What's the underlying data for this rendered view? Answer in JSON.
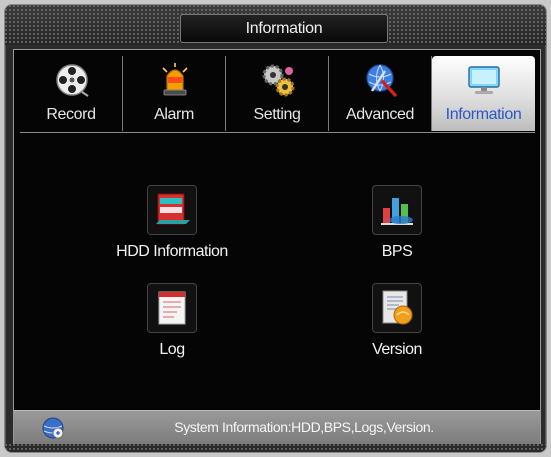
{
  "window": {
    "title": "Information"
  },
  "tabs": [
    {
      "label": "Record",
      "icon": "film-reel-icon"
    },
    {
      "label": "Alarm",
      "icon": "alarm-siren-icon"
    },
    {
      "label": "Setting",
      "icon": "gears-icon"
    },
    {
      "label": "Advanced",
      "icon": "globe-tools-icon"
    },
    {
      "label": "Information",
      "icon": "monitor-icon",
      "active": true
    }
  ],
  "items": [
    {
      "label": "HDD Information",
      "icon": "hdd-icon"
    },
    {
      "label": "BPS",
      "icon": "bar-chart-icon"
    },
    {
      "label": "Log",
      "icon": "log-document-icon"
    },
    {
      "label": "Version",
      "icon": "version-document-icon"
    }
  ],
  "status": {
    "text": "System Information:HDD,BPS,Logs,Version.",
    "icon": "info-globe-icon"
  },
  "colors": {
    "active_tab_text": "#2a57c8",
    "background": "#050505",
    "status_bar": "#8a8a8a"
  }
}
